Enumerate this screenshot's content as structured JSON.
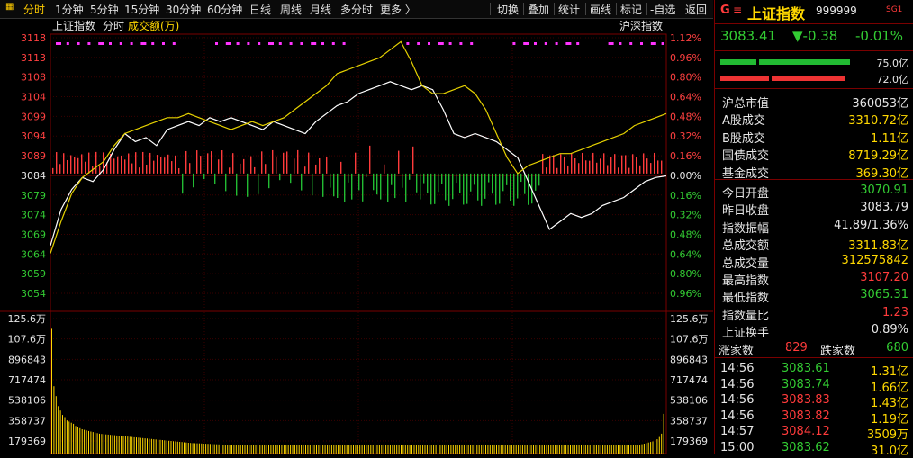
{
  "toolbar": {
    "items": [
      "分时",
      "1分钟",
      "5分钟",
      "15分钟",
      "30分钟",
      "60分钟",
      "日线",
      "周线",
      "月线",
      "多分时",
      "更多 〉"
    ],
    "right_items": [
      "切换",
      "叠加",
      "统计",
      "画线",
      "标记",
      "-自选",
      "返回"
    ]
  },
  "chart_legend": {
    "index_name": "上证指数",
    "mode": "分时",
    "volume_label": "成交额(万)",
    "compare_label": "沪深指数"
  },
  "price_axis_left": [
    "3118",
    "3113",
    "3108",
    "3104",
    "3099",
    "3094",
    "3089",
    "3084",
    "3079",
    "3074",
    "3069",
    "3064",
    "3059",
    "3054"
  ],
  "price_axis_right": [
    "1.12%",
    "0.96%",
    "0.80%",
    "0.64%",
    "0.48%",
    "0.32%",
    "0.16%",
    "0.00%",
    "0.16%",
    "0.32%",
    "0.48%",
    "0.64%",
    "0.80%",
    "0.96%"
  ],
  "volume_axis": [
    "125.6万",
    "107.6万",
    "896843",
    "717474",
    "538106",
    "358737",
    "179369"
  ],
  "chart_data": [
    {
      "type": "line",
      "title": "上证指数 分时",
      "ylim": [
        3054,
        3118
      ],
      "prev_close": 3083.79,
      "series": [
        {
          "name": "上证指数",
          "color": "#ffffff",
          "values": [
            3066,
            3075,
            3080,
            3083,
            3082,
            3085,
            3090,
            3094,
            3092,
            3093,
            3091,
            3095,
            3096,
            3097,
            3096,
            3098,
            3097,
            3098,
            3097,
            3096,
            3095,
            3097,
            3096,
            3095,
            3094,
            3097,
            3099,
            3101,
            3102,
            3104,
            3105,
            3106,
            3107,
            3106,
            3105,
            3106,
            3105,
            3100,
            3094,
            3093,
            3094,
            3093,
            3092,
            3090,
            3088,
            3082,
            3076,
            3070,
            3072,
            3074,
            3073,
            3074,
            3076,
            3077,
            3078,
            3080,
            3082,
            3083,
            3083.41
          ]
        },
        {
          "name": "沪深指数",
          "color": "#e6d200",
          "values": [
            3064,
            3072,
            3079,
            3083,
            3085,
            3087,
            3091,
            3094,
            3095,
            3096,
            3097,
            3098,
            3098,
            3099,
            3098,
            3097,
            3096,
            3095,
            3096,
            3097,
            3096,
            3097,
            3098,
            3100,
            3102,
            3104,
            3106,
            3109,
            3110,
            3111,
            3112,
            3113,
            3115,
            3117,
            3112,
            3106,
            3104,
            3104,
            3105,
            3106,
            3104,
            3100,
            3094,
            3088,
            3084,
            3086,
            3087,
            3088,
            3089,
            3089,
            3090,
            3091,
            3092,
            3093,
            3094,
            3096,
            3097,
            3098,
            3099
          ]
        }
      ]
    },
    {
      "type": "bar",
      "title": "成交额(万)",
      "ylim": [
        0,
        1256000
      ],
      "values": [
        1130000,
        610000,
        520000,
        430000,
        390000,
        350000,
        330000,
        300000,
        290000,
        280000,
        270000,
        250000,
        240000,
        230000,
        220000,
        215000,
        210000,
        205000,
        200000,
        195000,
        190000,
        185000,
        180000,
        178000,
        176000,
        174000,
        172000,
        170000,
        168000,
        166000,
        164000,
        162000,
        160000,
        158000,
        156000,
        154000,
        152000,
        150000,
        148000,
        146000,
        144000,
        142000,
        140000,
        138000,
        136000,
        134000,
        132000,
        130000,
        128000,
        126000,
        124000,
        122000,
        120000,
        118000,
        116000,
        114000,
        112000,
        110000,
        108000,
        106000,
        104000,
        102000,
        100000,
        98000,
        96000,
        95000,
        94000,
        93000,
        92000,
        91000,
        90000,
        89000,
        88000,
        87000,
        86000,
        85000,
        84000,
        83000,
        82000,
        81000,
        80000,
        80000,
        80000,
        80000,
        80000,
        80000,
        80000,
        80000,
        80000,
        80000,
        80000,
        80000,
        80000,
        80000,
        80000,
        80000,
        80000,
        80000,
        80000,
        80000,
        80000,
        80000,
        80000,
        80000,
        80000,
        80000,
        80000,
        80000,
        80000,
        80000,
        80000,
        80000,
        80000,
        80000,
        80000,
        80000,
        80000,
        80000,
        80000,
        80000,
        80000,
        80000,
        80000,
        80000,
        80000,
        80000,
        80000,
        80000,
        80000,
        80000,
        80000,
        80000,
        80000,
        80000,
        80000,
        80000,
        80000,
        80000,
        80000,
        80000,
        80000,
        80000,
        80000,
        80000,
        80000,
        80000,
        80000,
        80000,
        80000,
        80000,
        80000,
        80000,
        80000,
        80000,
        80000,
        80000,
        80000,
        80000,
        80000,
        80000,
        80000,
        80000,
        80000,
        80000,
        80000,
        80000,
        80000,
        80000,
        80000,
        80000,
        80000,
        80000,
        80000,
        80000,
        80000,
        80000,
        80000,
        80000,
        80000,
        80000,
        80000,
        80000,
        80000,
        80000,
        80000,
        80000,
        80000,
        80000,
        80000,
        80000,
        80000,
        80000,
        80000,
        80000,
        80000,
        80000,
        80000,
        80000,
        80000,
        80000,
        80000,
        80000,
        80000,
        80000,
        80000,
        80000,
        80000,
        80000,
        80000,
        80000,
        80000,
        80000,
        80000,
        80000,
        80000,
        80000,
        80000,
        80000,
        80000,
        80000,
        80000,
        80000,
        80000,
        80000,
        80000,
        80000,
        80000,
        80000,
        80000,
        80000,
        80000,
        80000,
        80000,
        80000,
        80000,
        80000,
        80000,
        80000,
        80000,
        80000,
        80000,
        80000,
        80000,
        80000,
        80000,
        80000,
        80000,
        80000,
        80000,
        80000,
        80000,
        80000,
        80000,
        80000,
        80000,
        80000,
        80000,
        80000,
        80000,
        80000,
        80000,
        80000,
        80000,
        80000,
        80000,
        80000,
        80000,
        80000,
        80000,
        80000,
        80000,
        80000,
        85000,
        90000,
        95000,
        100000,
        105000,
        110000,
        120000,
        130000,
        150000,
        180000,
        360000
      ]
    }
  ],
  "panel": {
    "logo": "G",
    "title": "上证指数",
    "code": "999999",
    "badge": "SG1",
    "price": "3083.41",
    "change": "▼-0.38",
    "change_pct": "-0.01%",
    "bars": [
      {
        "value": "75.0亿",
        "color": "#22bb33",
        "fill": 1.0
      },
      {
        "value": "72.0亿",
        "color": "#ee3333",
        "fill": 0.96
      }
    ],
    "group1": [
      {
        "label": "沪总市值",
        "value": "360053亿",
        "color": "white"
      },
      {
        "label": "A股成交",
        "value": "3310.72亿",
        "color": "yellow"
      },
      {
        "label": "B股成交",
        "value": "1.11亿",
        "color": "yellow"
      },
      {
        "label": "国债成交",
        "value": "8719.29亿",
        "color": "yellow"
      },
      {
        "label": "基金成交",
        "value": "369.30亿",
        "color": "yellow"
      }
    ],
    "group2": [
      {
        "label": "今日开盘",
        "value": "3070.91",
        "color": "green"
      },
      {
        "label": "昨日收盘",
        "value": "3083.79",
        "color": "white"
      },
      {
        "label": "指数振幅",
        "value": "41.89/1.36%",
        "color": "white"
      },
      {
        "label": "总成交额",
        "value": "3311.83亿",
        "color": "yellow"
      },
      {
        "label": "总成交量",
        "value": "312575842",
        "color": "yellow"
      },
      {
        "label": "最高指数",
        "value": "3107.20",
        "color": "red"
      },
      {
        "label": "最低指数",
        "value": "3065.31",
        "color": "green"
      },
      {
        "label": "指数量比",
        "value": "1.23",
        "color": "red"
      },
      {
        "label": "上证换手",
        "value": "0.89%",
        "color": "white"
      }
    ],
    "rise_label": "涨家数",
    "rise_count": "829",
    "fall_label": "跌家数",
    "fall_count": "680",
    "ticks": [
      {
        "time": "14:56",
        "price": "3083.61",
        "amount": "1.31亿",
        "price_color": "green"
      },
      {
        "time": "14:56",
        "price": "3083.74",
        "amount": "1.66亿",
        "price_color": "green"
      },
      {
        "time": "14:56",
        "price": "3083.83",
        "amount": "1.43亿",
        "price_color": "red"
      },
      {
        "time": "14:56",
        "price": "3083.82",
        "amount": "1.19亿",
        "price_color": "red"
      },
      {
        "time": "14:57",
        "price": "3084.12",
        "amount": "3509万",
        "price_color": "red"
      },
      {
        "time": "15:00",
        "price": "3083.62",
        "amount": "31.0亿",
        "price_color": "green"
      }
    ]
  }
}
